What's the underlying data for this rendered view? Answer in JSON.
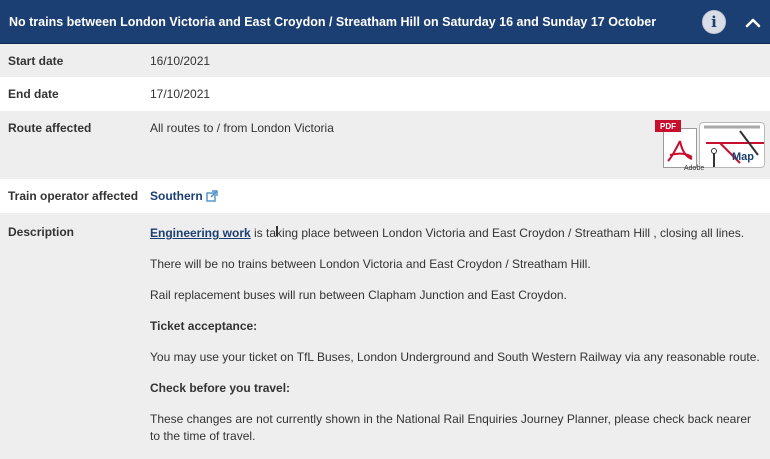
{
  "header": {
    "title": "No trains between London Victoria and East Croydon / Streatham Hill on Saturday 16 and Sunday 17 October",
    "info_icon": "info-icon",
    "collapse_icon": "chevron-up-icon"
  },
  "rows": {
    "start_date": {
      "label": "Start date",
      "value": "16/10/2021"
    },
    "end_date": {
      "label": "End date",
      "value": "17/10/2021"
    },
    "route": {
      "label": "Route affected",
      "value": "All routes to / from London Victoria",
      "map_button": {
        "pdf_tag": "PDF",
        "adobe": "Adobe",
        "label": "Map"
      }
    },
    "operator": {
      "label": "Train operator affected",
      "link": "Southern",
      "link_icon": "external-link-icon"
    },
    "description": {
      "label": "Description",
      "link": "Engineering work",
      "first_sentence": " is taking place between London Victoria and East Croydon / Streatham Hill , closing all lines.",
      "para2": "There will be no trains between London Victoria and East Croydon / Streatham Hill.",
      "para3": "Rail replacement buses will run between Clapham Junction and East Croydon.",
      "ticket_heading": "Ticket acceptance:",
      "ticket_text": "You may use your ticket on TfL Buses, London Underground and South Western Railway via any reasonable route.",
      "check_heading": "Check before you travel:",
      "check_text": "These changes are not currently shown in the National Rail Enquiries Journey Planner, please check back nearer to the time of travel."
    }
  },
  "colors": {
    "header_bg": "#1c3f73",
    "row_shade": "#eeeeee",
    "link": "#1c3f73",
    "pdf_red": "#c8102e"
  }
}
